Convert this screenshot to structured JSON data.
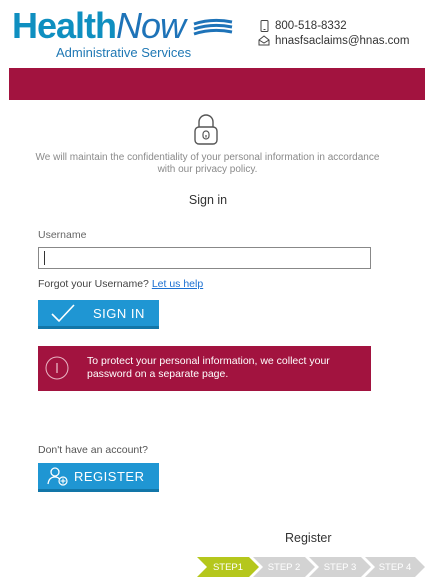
{
  "header": {
    "logo_health": "Health",
    "logo_now": "Now",
    "logo_subtitle": "Administrative Services",
    "phone": "800-518-8332",
    "email": "hnasfsaclaims@hnas.com"
  },
  "signin": {
    "privacy_text": "We will maintain the confidentiality of your personal information in accordance with our privacy policy.",
    "title": "Sign in",
    "username_label": "Username",
    "username_value": "",
    "forgot_text": "Forgot your Username?",
    "forgot_link": "Let us help",
    "button_label": "SIGN IN",
    "notice": "To protect your personal information, we collect your password on a separate page."
  },
  "register": {
    "prompt": "Don't have an account?",
    "button_label": "REGISTER",
    "title": "Register",
    "steps": [
      "STEP1",
      "STEP 2",
      "STEP 3",
      "STEP 4"
    ],
    "active_step": 1
  },
  "colors": {
    "brand_crimson": "#a2133f",
    "button_blue": "#1f96d3",
    "step_active": "#b5c71c",
    "step_inactive": "#d3d3d3"
  },
  "icons": {
    "phone": "mobile-phone-icon",
    "email": "home-mail-icon",
    "lock": "padlock-icon",
    "signin": "checkmark-icon",
    "alert": "info-icon",
    "register": "add-user-icon"
  }
}
